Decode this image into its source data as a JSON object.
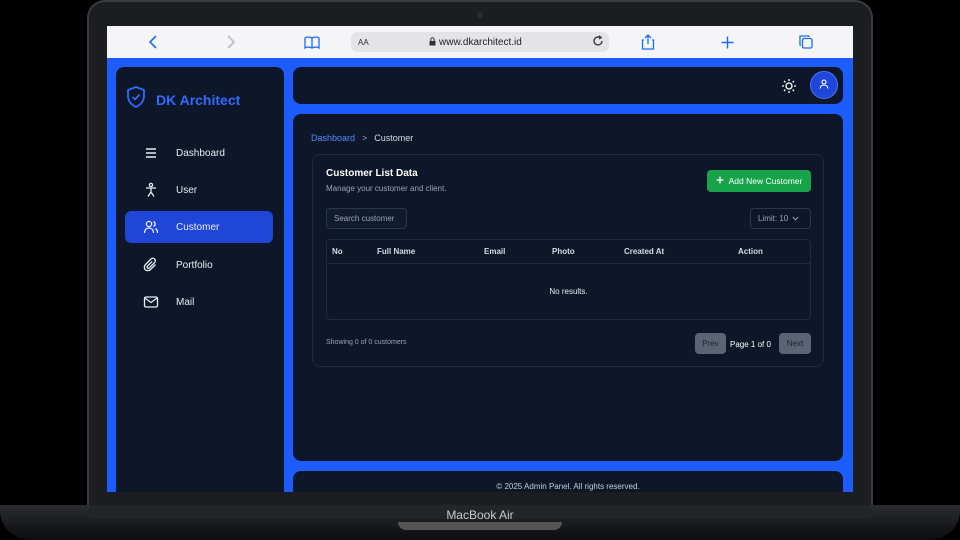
{
  "device": {
    "model": "MacBook Air"
  },
  "browser": {
    "text_size_label": "AA",
    "url": "www.dkarchitect.id",
    "icons": [
      "back-icon",
      "forward-icon",
      "book-icon",
      "lock-icon",
      "reload-icon",
      "share-icon",
      "plus-icon",
      "tabs-icon"
    ]
  },
  "brand": {
    "name": "DK Architect",
    "icon": "shield-icon",
    "color": "#2f6bff"
  },
  "sidebar": {
    "items": [
      {
        "label": "Dashboard",
        "icon": "menu-icon",
        "active": false
      },
      {
        "label": "User",
        "icon": "person-icon",
        "active": false
      },
      {
        "label": "Customer",
        "icon": "users-icon",
        "active": true
      },
      {
        "label": "Portfolio",
        "icon": "paperclip-icon",
        "active": false
      },
      {
        "label": "Mail",
        "icon": "mail-icon",
        "active": false
      }
    ]
  },
  "topbar": {
    "theme_icon": "sun-icon",
    "avatar_icon": "user-icon"
  },
  "breadcrumb": {
    "parent": "Dashboard",
    "separator": ">",
    "current": "Customer"
  },
  "card": {
    "title": "Customer List Data",
    "subtitle": "Manage your customer and client.",
    "add_button": "Add New Customer",
    "search_placeholder": "Search customer",
    "limit_label": "Limit: 10"
  },
  "table": {
    "columns": [
      "No",
      "Full Name",
      "Email",
      "Photo",
      "Created At",
      "Action"
    ],
    "empty_text": "No results."
  },
  "pagination": {
    "summary": "Showing 0 of 0 customers",
    "prev": "Prev",
    "page_info": "Page 1 of 0",
    "next": "Next"
  },
  "footer": {
    "text": "© 2025 Admin Panel. All rights reserved."
  },
  "colors": {
    "accent": "#1f46d6",
    "frame": "#1d5cff",
    "panel": "#0e1729",
    "success": "#16a34a"
  }
}
